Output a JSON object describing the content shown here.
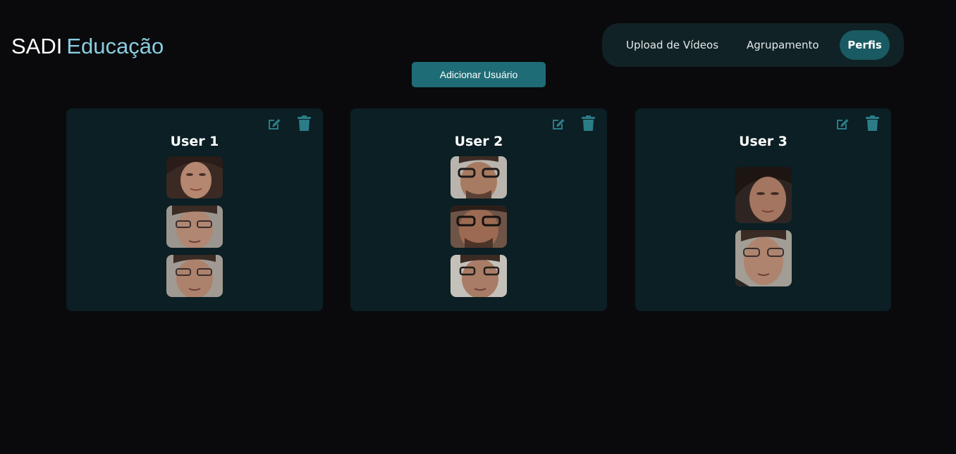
{
  "brand": {
    "part1": "SADI",
    "part2": "Educação"
  },
  "nav": {
    "items": [
      {
        "label": "Upload de Vídeos"
      },
      {
        "label": "Agrupamento"
      },
      {
        "label": "Perfis",
        "active": true
      }
    ]
  },
  "actions": {
    "add_user_label": "Adicionar Usuário"
  },
  "users": [
    {
      "name": "User 1",
      "photo_count": 3
    },
    {
      "name": "User 2",
      "photo_count": 3
    },
    {
      "name": "User 3",
      "photo_count": 2
    }
  ],
  "icons": {
    "edit": "pencil-square-icon",
    "delete": "trash-icon"
  },
  "colors": {
    "background": "#0a0a0c",
    "card": "#0b1f24",
    "accent": "#1e6c76",
    "brand_accent": "#89cde0",
    "icon": "#2b7c86"
  }
}
